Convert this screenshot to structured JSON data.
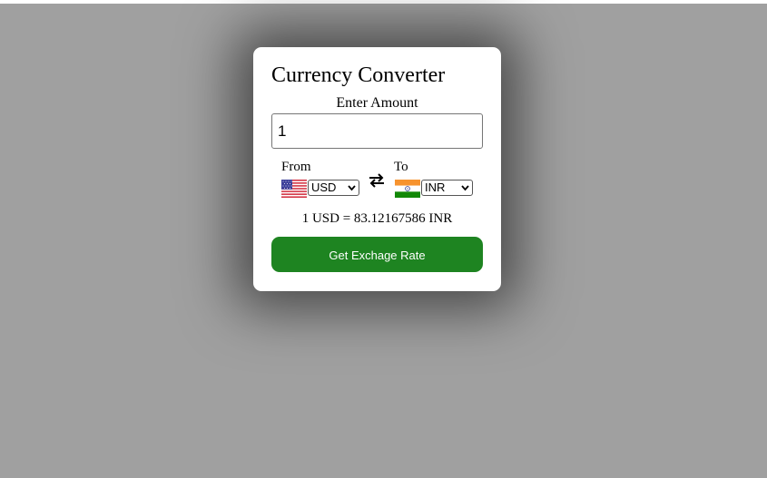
{
  "converter": {
    "title": "Currency Converter",
    "amount_label": "Enter Amount",
    "amount_value": "1",
    "from_label": "From",
    "to_label": "To",
    "from_currency": "USD",
    "to_currency": "INR",
    "from_flag": "us-flag-icon",
    "to_flag": "india-flag-icon",
    "swap_icon": "swap-arrows-icon",
    "rate_text": "1 USD = 83.12167586 INR",
    "button_label": "Get Exchage Rate"
  },
  "colors": {
    "background": "#a0a0a0",
    "card": "#ffffff",
    "button": "#1e8421",
    "button_text": "#ffffff"
  }
}
